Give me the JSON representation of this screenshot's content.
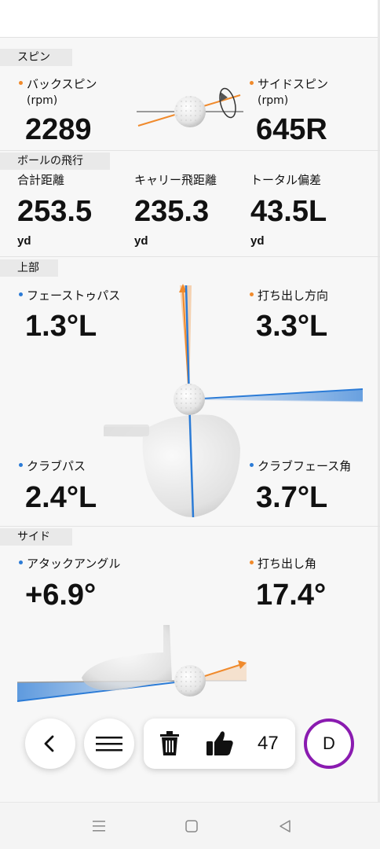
{
  "colors": {
    "accent_orange": "#f08a2c",
    "accent_blue": "#2b7bd6",
    "avatar_ring": "#8a1bb0"
  },
  "spin": {
    "section_label": "スピン",
    "back_spin_label": "バックスピン",
    "back_spin_unit": "(rpm)",
    "back_spin_value": "2289",
    "side_spin_label": "サイドスピン",
    "side_spin_unit": "(rpm)",
    "side_spin_value": "645R"
  },
  "flight": {
    "section_label": "ボールの飛行",
    "total_label": "合計距離",
    "total_value": "253.5",
    "total_unit": "yd",
    "carry_label": "キャリー飛距離",
    "carry_value": "235.3",
    "carry_unit": "yd",
    "deviation_label": "トータル偏差",
    "deviation_value": "43.5L",
    "deviation_unit": "yd"
  },
  "top": {
    "section_label": "上部",
    "face_to_path_label": "フェーストゥパス",
    "face_to_path_value": "1.3°L",
    "launch_direction_label": "打ち出し方向",
    "launch_direction_value": "3.3°L",
    "club_path_label": "クラブパス",
    "club_path_value": "2.4°L",
    "face_angle_label": "クラブフェース角",
    "face_angle_value": "3.7°L"
  },
  "side": {
    "section_label": "サイド",
    "attack_angle_label": "アタックアングル",
    "attack_angle_value": "+6.9°",
    "launch_angle_label": "打ち出し角",
    "launch_angle_value": "17.4°"
  },
  "toolbar": {
    "back_icon": "chevron-left-icon",
    "menu_icon": "hamburger-menu-icon",
    "delete_icon": "trash-icon",
    "like_icon": "thumbs-up-icon",
    "like_count": "47",
    "avatar_letter": "D"
  },
  "navbar": {
    "recent_icon": "recent-apps-icon",
    "home_icon": "home-icon",
    "back_icon": "back-triangle-icon"
  }
}
